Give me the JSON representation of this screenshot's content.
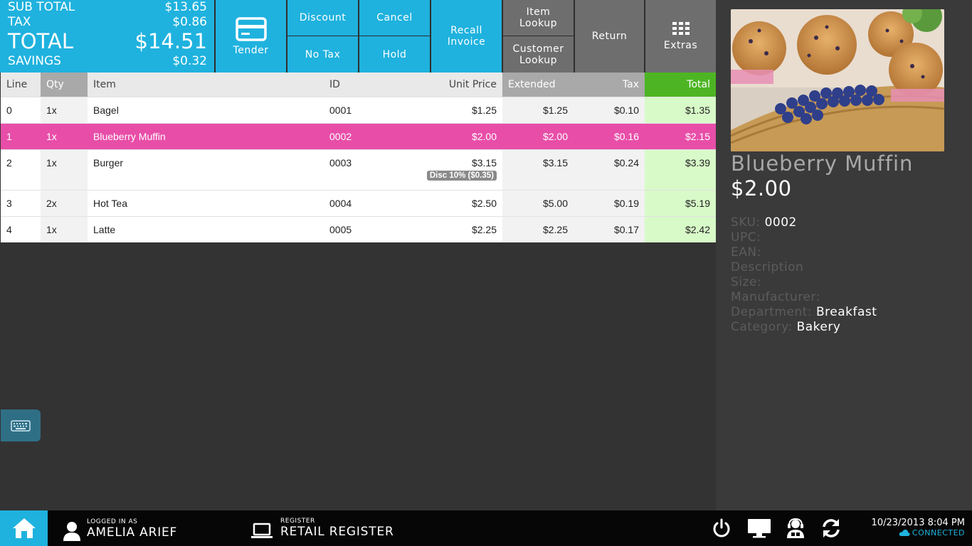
{
  "totals": {
    "subtotal_label": "SUB TOTAL",
    "subtotal": "$13.65",
    "tax_label": "TAX",
    "tax": "$0.86",
    "total_label": "TOTAL",
    "total": "$14.51",
    "savings_label": "SAVINGS",
    "savings": "$0.32"
  },
  "buttons": {
    "tender": "Tender",
    "discount": "Discount",
    "no_tax": "No Tax",
    "cancel": "Cancel",
    "hold": "Hold",
    "recall_1": "Recall",
    "recall_2": "Invoice",
    "item_lookup_1": "Item",
    "item_lookup_2": "Lookup",
    "customer_lookup_1": "Customer",
    "customer_lookup_2": "Lookup",
    "return": "Return",
    "extras": "Extras"
  },
  "table": {
    "headers": {
      "line": "Line",
      "qty": "Qty",
      "item": "Item",
      "id": "ID",
      "unit_price": "Unit Price",
      "extended": "Extended",
      "tax": "Tax",
      "total": "Total"
    },
    "rows": [
      {
        "line": "0",
        "qty": "1x",
        "item": "Bagel",
        "id": "0001",
        "unit_price": "$1.25",
        "extended": "$1.25",
        "tax": "$0.10",
        "total": "$1.35"
      },
      {
        "line": "1",
        "qty": "1x",
        "item": "Blueberry Muffin",
        "id": "0002",
        "unit_price": "$2.00",
        "extended": "$2.00",
        "tax": "$0.16",
        "total": "$2.15"
      },
      {
        "line": "2",
        "qty": "1x",
        "item": "Burger",
        "id": "0003",
        "unit_price": "$3.15",
        "discount": "Disc 10% ($0.35)",
        "extended": "$3.15",
        "tax": "$0.24",
        "total": "$3.39"
      },
      {
        "line": "3",
        "qty": "2x",
        "item": "Hot Tea",
        "id": "0004",
        "unit_price": "$2.50",
        "extended": "$5.00",
        "tax": "$0.19",
        "total": "$5.19"
      },
      {
        "line": "4",
        "qty": "1x",
        "item": "Latte",
        "id": "0005",
        "unit_price": "$2.25",
        "extended": "$2.25",
        "tax": "$0.17",
        "total": "$2.42"
      }
    ]
  },
  "product": {
    "name": "Blueberry Muffin",
    "price": "$2.00",
    "sku_label": "SKU:",
    "sku": "0002",
    "upc_label": "UPC:",
    "ean_label": "EAN:",
    "description_label": "Description",
    "size_label": "Size:",
    "manufacturer_label": "Manufacturer:",
    "department_label": "Department:",
    "department": "Breakfast",
    "category_label": "Category:",
    "category": "Bakery"
  },
  "status": {
    "logged_in_label": "LOGGED IN AS",
    "user": "AMELIA ARIEF",
    "register_label": "REGISTER",
    "register": "RETAIL REGISTER",
    "datetime": "10/23/2013 8:04 PM",
    "connection": "CONNECTED"
  },
  "colors": {
    "accent": "#1fb2de",
    "selected_row": "#e84ea8",
    "total_header": "#4db523",
    "total_cell": "#d8fac8"
  }
}
